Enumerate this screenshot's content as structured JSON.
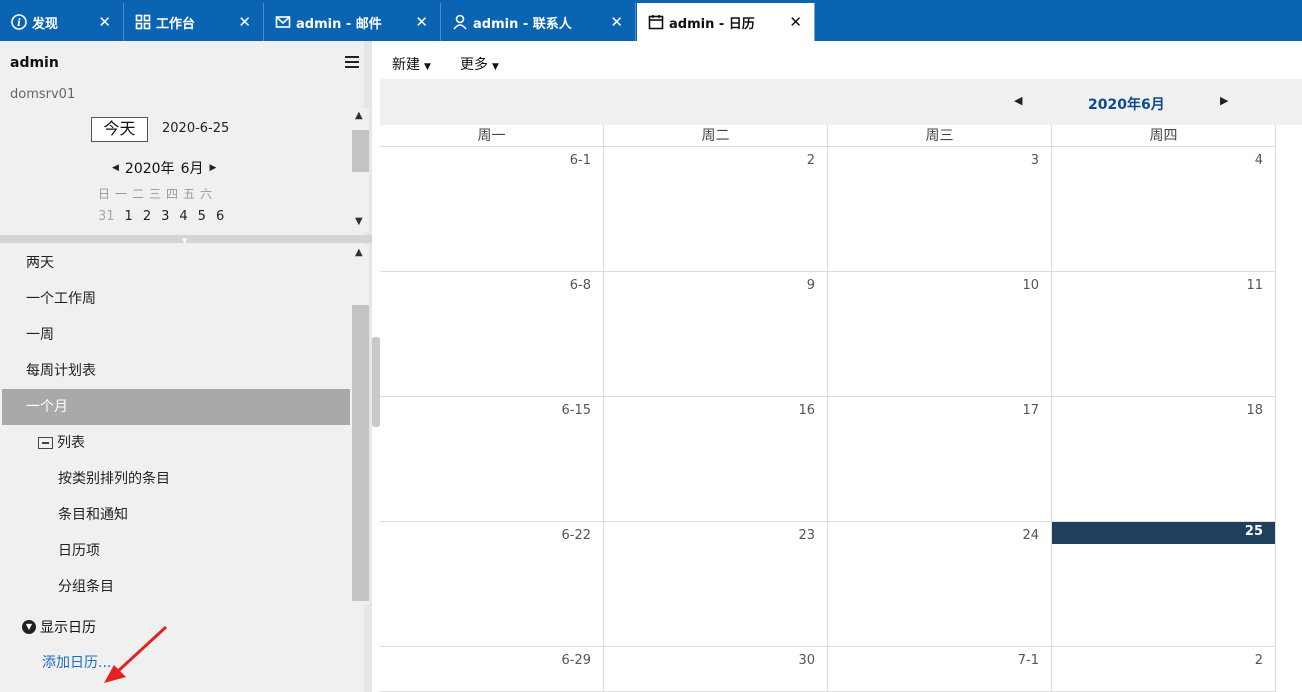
{
  "tabs": [
    {
      "label": "发现",
      "icon": "info-icon"
    },
    {
      "label": "工作台",
      "icon": "apps-icon"
    },
    {
      "label": "admin - 邮件",
      "icon": "mail-icon"
    },
    {
      "label": "admin - 联系人",
      "icon": "contact-icon"
    },
    {
      "label": "admin - 日历",
      "icon": "calendar-icon"
    }
  ],
  "sidebar": {
    "user": "admin",
    "server": "domsrv01",
    "today_label": "今天",
    "today_date": "2020-6-25",
    "mini_year": "2020年",
    "mini_month": "6月",
    "weekdays": "日一二三四五六",
    "mini_days": [
      "31",
      "1",
      "2",
      "3",
      "4",
      "5",
      "6"
    ],
    "views": [
      "两天",
      "一个工作周",
      "一周",
      "每周计划表",
      "一个月"
    ],
    "folder_label": "列表",
    "list_items": [
      "按类别排列的条目",
      "条目和通知",
      "日历项",
      "分组条目"
    ],
    "show_calendars": "显示日历",
    "add_calendar": "添加日历..."
  },
  "toolbar": {
    "new_label": "新建",
    "more_label": "更多"
  },
  "calendar": {
    "title": "2020年6月",
    "weekdays": [
      "周一",
      "周二",
      "周三",
      "周四"
    ],
    "weeks": [
      [
        "6-1",
        "2",
        "3",
        "4"
      ],
      [
        "6-8",
        "9",
        "10",
        "11"
      ],
      [
        "6-15",
        "16",
        "17",
        "18"
      ],
      [
        "6-22",
        "23",
        "24",
        "25"
      ],
      [
        "6-29",
        "30",
        "7-1",
        "2"
      ]
    ],
    "today_value": "25",
    "today_color": "#1e3f5e",
    "accent_color": "#0b64b1"
  }
}
